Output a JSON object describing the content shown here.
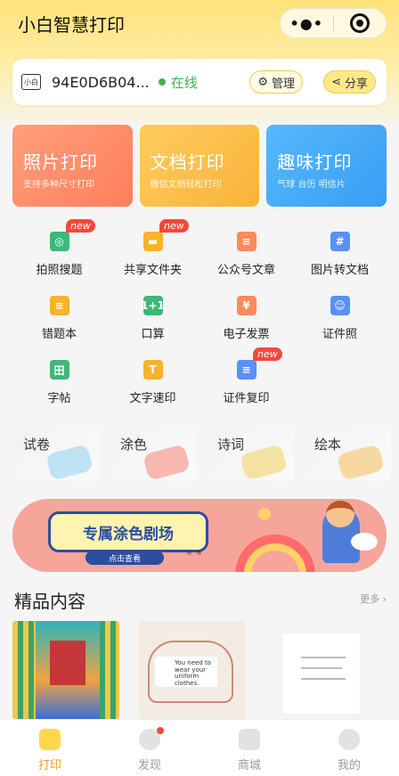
{
  "header": {
    "title": "小白智慧打印"
  },
  "capsule": {
    "more_glyph": "•●•"
  },
  "device": {
    "icon_label": "小白",
    "id": "94E0D6B04...",
    "status": "在线",
    "manage_label": "管理",
    "share_label": "分享"
  },
  "big_cards": [
    {
      "title": "照片打印",
      "subtitle": "支持多种尺寸打印"
    },
    {
      "title": "文档打印",
      "subtitle": "微信文档轻松打印"
    },
    {
      "title": "趣味打印",
      "subtitle": "气球 台历 明信片"
    }
  ],
  "grid": [
    {
      "label": "拍照搜题",
      "badge": "new",
      "color": "#3cb878",
      "icon": "camera-icon"
    },
    {
      "label": "共享文件夹",
      "badge": "new",
      "color": "#f8b22c",
      "icon": "folder-icon"
    },
    {
      "label": "公众号文章",
      "badge": "",
      "color": "#ff8a5c",
      "icon": "article-icon"
    },
    {
      "label": "图片转文档",
      "badge": "",
      "color": "#5b8ff9",
      "icon": "image-doc-icon"
    },
    {
      "label": "错题本",
      "badge": "",
      "color": "#f8b22c",
      "icon": "notebook-icon"
    },
    {
      "label": "口算",
      "badge": "",
      "color": "#3cb878",
      "icon": "math-icon"
    },
    {
      "label": "电子发票",
      "badge": "",
      "color": "#ff8a5c",
      "icon": "invoice-icon"
    },
    {
      "label": "证件照",
      "badge": "",
      "color": "#5b8ff9",
      "icon": "id-photo-icon"
    },
    {
      "label": "字帖",
      "badge": "",
      "color": "#3cb878",
      "icon": "copybook-icon"
    },
    {
      "label": "文字速印",
      "badge": "",
      "color": "#f8b22c",
      "icon": "text-print-icon"
    },
    {
      "label": "证件复印",
      "badge": "new",
      "color": "#5b8ff9",
      "icon": "id-copy-icon"
    }
  ],
  "grid_glyphs": [
    "◎",
    "▬",
    "≡",
    "#",
    "≡",
    "1+1",
    "¥",
    "☺",
    "田",
    "T",
    "≡"
  ],
  "categories": [
    {
      "label": "试卷",
      "color": "#bfe2f5"
    },
    {
      "label": "涂色",
      "color": "#f7b8b0"
    },
    {
      "label": "诗词",
      "color": "#f5e3a3"
    },
    {
      "label": "绘本",
      "color": "#f5d9a0"
    }
  ],
  "banner": {
    "title": "专属涂色剧场",
    "cta": "点击查看"
  },
  "section": {
    "title": "精品内容",
    "more": "更多 ›"
  },
  "content_card2_text": "You need to wear your uniform clothes.",
  "tabs": [
    {
      "label": "打印",
      "active": true,
      "icon": "home-icon"
    },
    {
      "label": "发现",
      "active": false,
      "icon": "discover-icon"
    },
    {
      "label": "商城",
      "active": false,
      "icon": "shop-icon"
    },
    {
      "label": "我的",
      "active": false,
      "icon": "profile-icon"
    }
  ]
}
